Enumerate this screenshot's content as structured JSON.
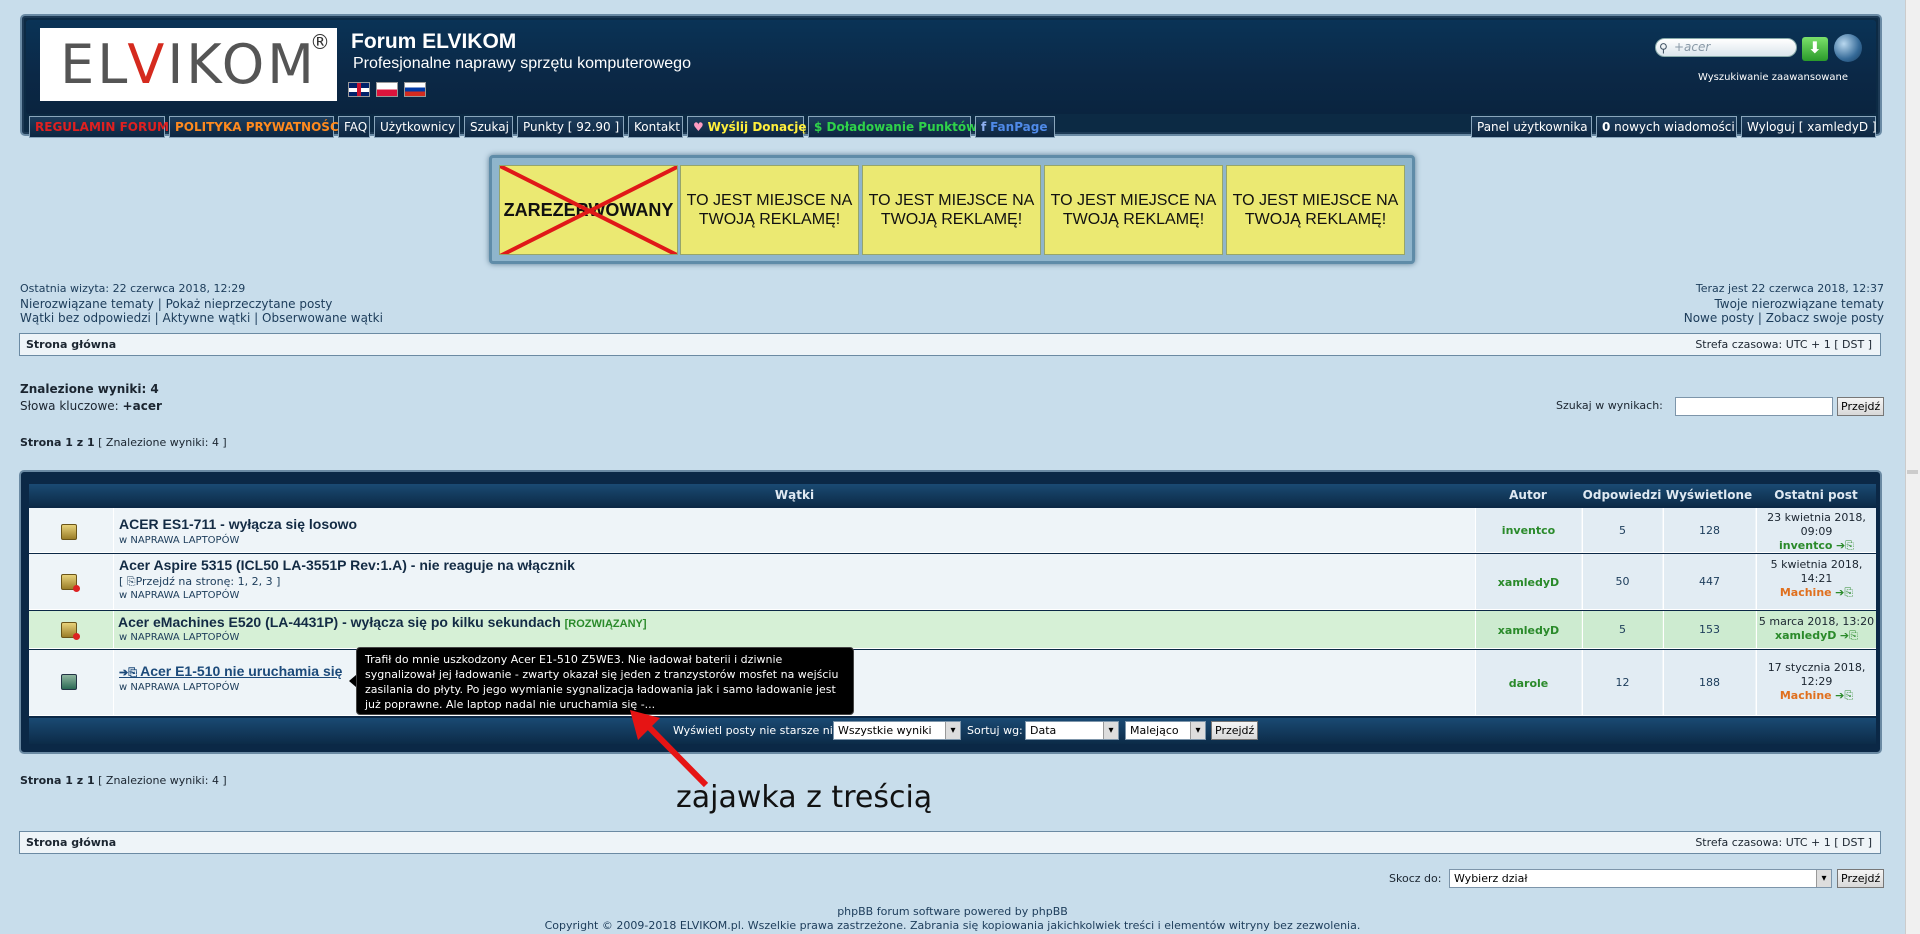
{
  "header": {
    "logo_text": "ELVIKOM",
    "logo_reg": "®",
    "title": "Forum ELVIKOM",
    "description": "Profesjonalne naprawy sprzętu komputerowego",
    "search_value": "+acer",
    "advanced_search": "Wyszukiwanie zaawansowane"
  },
  "nav": {
    "rules": "REGULAMIN FORUM",
    "privacy": "POLITYKA PRYWATNOŚCI",
    "faq": "FAQ",
    "users": "Użytkownicy",
    "search": "Szukaj",
    "points": "Punkty  [ 92.90 ]",
    "contact": "Kontakt",
    "donate": "Wyślij Donację",
    "topup": "$ Doładowanie Punktów",
    "fanpage": "FanPage",
    "panel": "Panel użytkownika",
    "messages_count": "0",
    "messages": " nowych wiadomości",
    "logout": "Wyloguj [ xamledyD ]"
  },
  "ads": {
    "reserved": "ZAREZERWOWANY",
    "ad_text": "TO JEST MIEJSCE NA TWOJĄ REKLAMĘ!"
  },
  "stats": {
    "last_visit": "Ostatnia wizyta: 22 czerwca 2018, 12:29",
    "unanswered": "Nierozwiązane tematy",
    "unread": "Pokaż nieprzeczytane posty",
    "no_reply": "Wątki bez odpowiedzi",
    "active": "Aktywne wątki",
    "watched": "Obserwowane wątki",
    "now": "Teraz jest 22 czerwca 2018, 12:37",
    "your_unanswered": "Twoje nierozwiązane tematy",
    "new_posts": "Nowe posty",
    "your_posts": "Zobacz swoje posty",
    "sep": "|"
  },
  "breadcrumb": {
    "home": "Strona główna",
    "timezone": "Strefa czasowa: UTC + 1 [ DST ]"
  },
  "results": {
    "title": "Znalezione wyniki: 4",
    "keywords_label": "Słowa kluczowe: ",
    "keywords": "+acer",
    "search_in_label": "Szukaj w wynikach:",
    "go": "Przejdź",
    "page_bold": "Strona 1 z 1",
    "page_rest": " [ Znalezione wyniki: 4 ]"
  },
  "table": {
    "headers": {
      "topics": "Wątki",
      "author": "Autor",
      "replies": "Odpowiedzi",
      "views": "Wyświetlone",
      "last": "Ostatni post"
    },
    "rows": [
      {
        "title": "ACER ES1-711 - wyłącza się losowo",
        "forum": "w NAPRAWA LAPTOPÓW",
        "author": "inventco",
        "replies": "5",
        "views": "128",
        "last_date": "23 kwietnia 2018, 09:09",
        "last_author": "inventco"
      },
      {
        "title": "Acer Aspire 5315 (ICL50 LA-3551P Rev:1.A) - nie reaguje na włącznik",
        "pages": "[ ⎘Przejdź na stronę: 1, 2, 3 ]",
        "forum": "w NAPRAWA LAPTOPÓW",
        "author": "xamledyD",
        "replies": "50",
        "views": "447",
        "last_date": "5 kwietnia 2018, 14:21",
        "last_author": "Machine"
      },
      {
        "title": "Acer eMachines E520 (LA-4431P) - wyłącza się po kilku sekundach",
        "solved": "[ROZWIĄZANY]",
        "forum": "w NAPRAWA LAPTOPÓW",
        "author": "xamledyD",
        "replies": "5",
        "views": "153",
        "last_date": "5 marca 2018, 13:20",
        "last_author": "xamledyD"
      },
      {
        "title": "Acer E1-510 nie uruchamia się",
        "forum": "w NAPRAWA LAPTOPÓW",
        "author": "darole",
        "replies": "12",
        "views": "188",
        "last_date": "17 stycznia 2018, 12:29",
        "last_author": "Machine"
      }
    ],
    "footer": {
      "show_label": "Wyświetl posty nie starsze niż:",
      "show_value": "Wszystkie wyniki",
      "sort_label": "Sortuj wg:",
      "sort_value": "Data",
      "order_value": "Malejąco",
      "go": "Przejdź"
    }
  },
  "tooltip": {
    "text": "Trafił do mnie uszkodzony Acer E1-510 Z5WE3. Nie ładował baterii i dziwnie sygnalizował jej ładowanie - zwarty okazał się jeden z tranzystorów mosfet na wejściu zasilania do płyty. Po jego wymianie sygnalizacja ładowania jak i samo ładowanie jest już poprawne. Ale laptop nadal nie uruchamia się -..."
  },
  "annotation": "zajawka z treścią",
  "bottom": {
    "jump_label": "Skocz do:",
    "jump_value": "Wybierz dział",
    "go": "Przejdź",
    "powered": "phpBB forum software powered by phpBB",
    "copyright": "Copyright © 2009-2018 ELVIKOM.pl. Wszelkie prawa zastrzeżone. Zabrania się kopiowania jakichkolwiek treści i elementów witryny bez zezwolenia."
  },
  "colors": {
    "accent": "#0b2846",
    "solved_row": "#d6f0d6",
    "author_green": "#2a8a2a",
    "author_orange": "#e0701e"
  }
}
